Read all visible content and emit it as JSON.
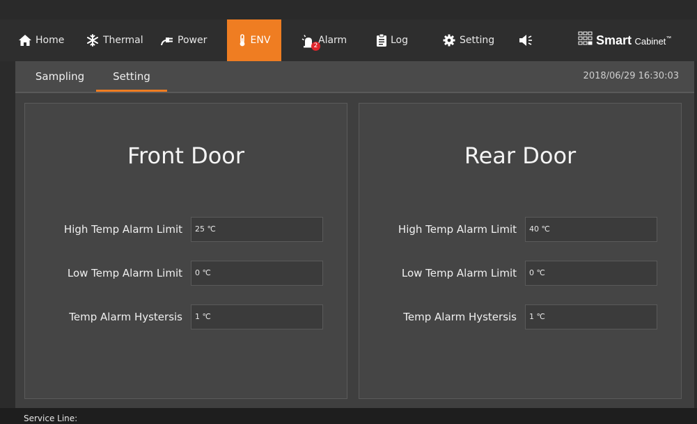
{
  "nav": {
    "items": [
      {
        "label": "Home",
        "icon": "home-icon"
      },
      {
        "label": "Thermal",
        "icon": "snowflake-icon"
      },
      {
        "label": "Power",
        "icon": "plug-icon"
      },
      {
        "label": "ENV",
        "icon": "thermometer-icon",
        "active": true
      },
      {
        "label": "Alarm",
        "icon": "alarm-siren-icon",
        "badge": "2"
      },
      {
        "label": "Log",
        "icon": "clipboard-icon"
      },
      {
        "label": "Setting",
        "icon": "gear-icon"
      }
    ],
    "sound_icon": "speaker-icon",
    "accent_color": "#ef7d22",
    "badge_color": "#e0262b"
  },
  "logo": {
    "bold": "Smart",
    "light": "Cabinet",
    "mark": "™"
  },
  "subnav": {
    "tabs": [
      {
        "label": "Sampling"
      },
      {
        "label": "Setting",
        "active": true
      }
    ],
    "datetime": "2018/06/29 16:30:03"
  },
  "panels": [
    {
      "title": "Front Door",
      "fields": [
        {
          "label": "High Temp Alarm Limit",
          "value": "25 ℃"
        },
        {
          "label": "Low Temp Alarm Limit",
          "value": "0 ℃"
        },
        {
          "label": "Temp Alarm Hystersis",
          "value": "1 ℃"
        }
      ]
    },
    {
      "title": "Rear Door",
      "fields": [
        {
          "label": "High Temp Alarm Limit",
          "value": "40 ℃"
        },
        {
          "label": "Low Temp Alarm Limit",
          "value": "0 ℃"
        },
        {
          "label": "Temp Alarm Hystersis",
          "value": "1 ℃"
        }
      ]
    }
  ],
  "footer": {
    "service_line": "Service Line:"
  }
}
